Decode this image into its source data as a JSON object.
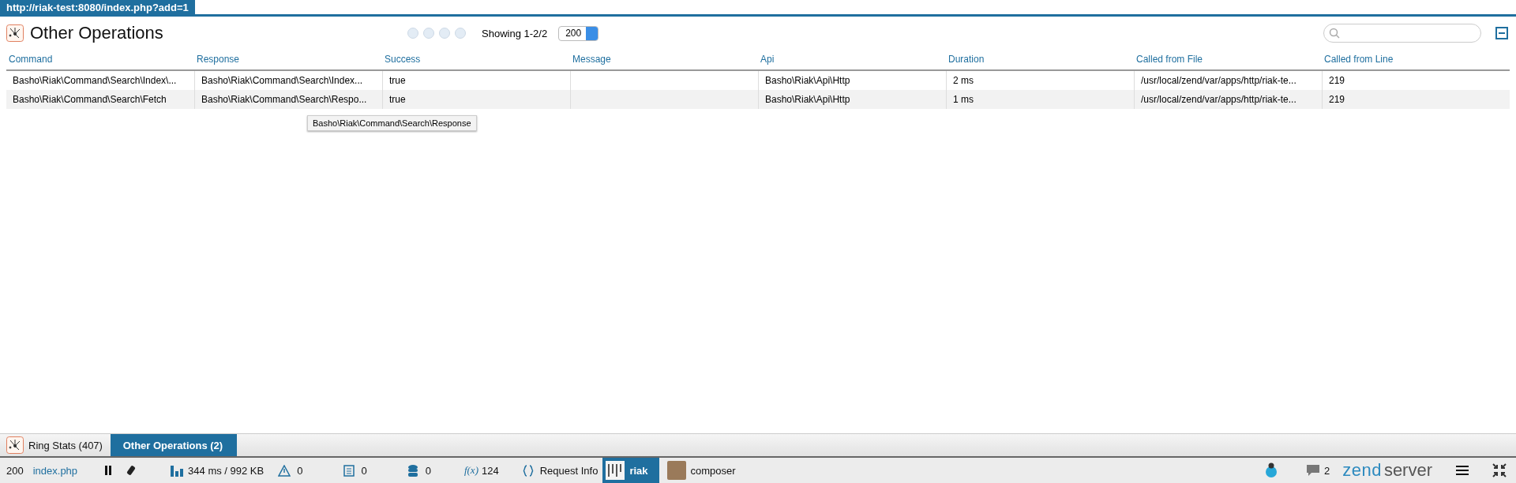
{
  "url_tab": "http://riak-test:8080/index.php?add=1",
  "panel": {
    "title": "Other Operations",
    "showing": "Showing 1-2/2",
    "page_size": "200"
  },
  "table": {
    "columns": [
      "Command",
      "Response",
      "Success",
      "Message",
      "Api",
      "Duration",
      "Called from File",
      "Called from Line"
    ],
    "rows": [
      {
        "selected": false,
        "cells": [
          "Basho\\Riak\\Command\\Search\\Index\\...",
          "Basho\\Riak\\Command\\Search\\Index...",
          "true",
          "",
          "Basho\\Riak\\Api\\Http",
          "2 ms",
          "/usr/local/zend/var/apps/http/riak-te...",
          "219"
        ]
      },
      {
        "selected": true,
        "cells": [
          "Basho\\Riak\\Command\\Search\\Fetch",
          "Basho\\Riak\\Command\\Search\\Respo...",
          "true",
          "",
          "Basho\\Riak\\Api\\Http",
          "1 ms",
          "/usr/local/zend/var/apps/http/riak-te...",
          "219"
        ]
      }
    ]
  },
  "tooltip": "Basho\\Riak\\Command\\Search\\Response",
  "bottom_tabs": [
    {
      "label": "Ring Stats (407)",
      "selected": false
    },
    {
      "label": "Other Operations (2)",
      "selected": true
    }
  ],
  "status_bar": {
    "code": "200",
    "file": "index.php",
    "timing": "344 ms / 992 KB",
    "warnings": "0",
    "logs": "0",
    "queries": "0",
    "functions_icon": "f(x)",
    "functions": "124",
    "request_info": "Request Info",
    "riak": "riak",
    "composer": "composer",
    "messages": "2",
    "logo_main": "zend",
    "logo_sub": "server"
  }
}
